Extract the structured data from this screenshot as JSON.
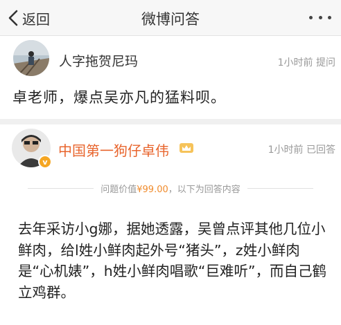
{
  "nav": {
    "back_label": "返回",
    "title": "微博问答"
  },
  "question": {
    "asker_name": "人字拖贺尼玛",
    "meta": "1小时前 提问",
    "text": "卓老师，爆点吴亦凡的猛料呗。"
  },
  "answer": {
    "answerer_name": "中国第一狗仔卓伟",
    "verified_badge": "v",
    "meta": "1小时前 已回答",
    "price_prefix": "问题价值",
    "price_amount": "¥99.00",
    "price_suffix": "，以下为回答内容",
    "body": "去年采访小g娜，据她透露，吴曾点评其他几位小鲜肉，给l姓小鲜肉起外号“猪头”，z姓小鲜肉是“心机婊”，h姓小鲜肉唱歌“巨难听”，而自己鹤立鸡群。"
  },
  "icons": {
    "back": "chevron-left-icon",
    "more": "more-dots-icon",
    "crown": "crown-icon",
    "verified": "verified-icon"
  },
  "colors": {
    "answerer_name": "#e8642c",
    "price_amount": "#f08b2c",
    "verified_badge": "#f5a623",
    "meta_gray": "#999999"
  }
}
